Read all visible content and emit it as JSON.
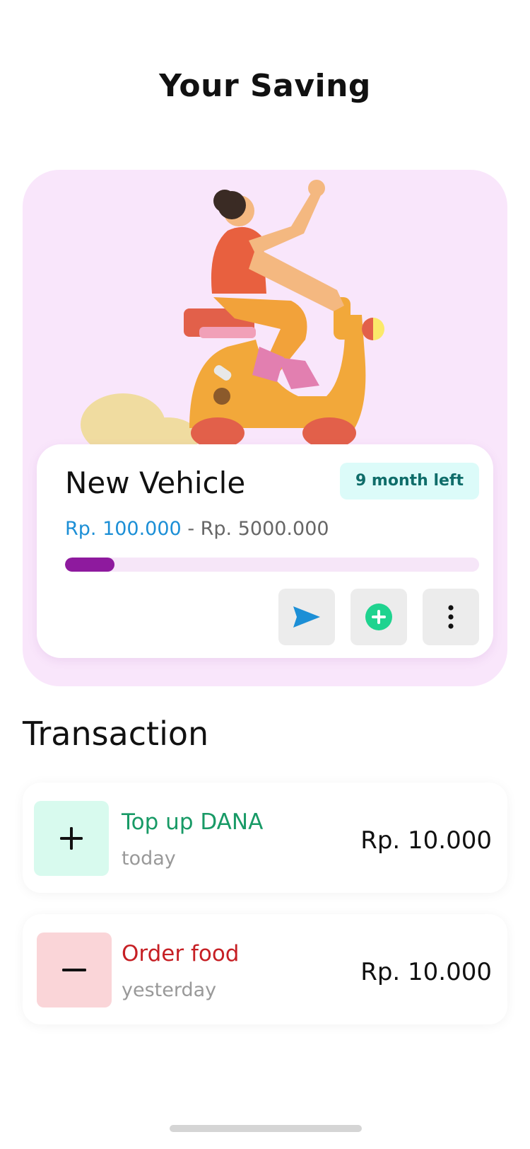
{
  "page": {
    "title": "Your Saving"
  },
  "goal": {
    "name": "New Vehicle",
    "badge": "9 month left",
    "current_amount": "Rp. 100.000",
    "separator": "-",
    "target_amount": "Rp. 5000.000",
    "progress_fraction": 0.12,
    "accent_color": "#8e1a9e"
  },
  "actions": {
    "send": {
      "icon": "send-icon",
      "color": "#1c8fd6"
    },
    "add": {
      "icon": "plus-circle-icon",
      "color": "#1fd38f"
    },
    "more": {
      "icon": "more-vertical-icon",
      "color": "#111111"
    }
  },
  "transactions": {
    "title": "Transaction",
    "items": [
      {
        "title": "Top up DANA",
        "date": "today",
        "amount": "Rp. 10.000",
        "type": "income",
        "icon": "plus-icon",
        "color": "#189a66"
      },
      {
        "title": "Order food",
        "date": "yesterday",
        "amount": "Rp. 10.000",
        "type": "expense",
        "icon": "minus-icon",
        "color": "#c61f24"
      }
    ]
  }
}
